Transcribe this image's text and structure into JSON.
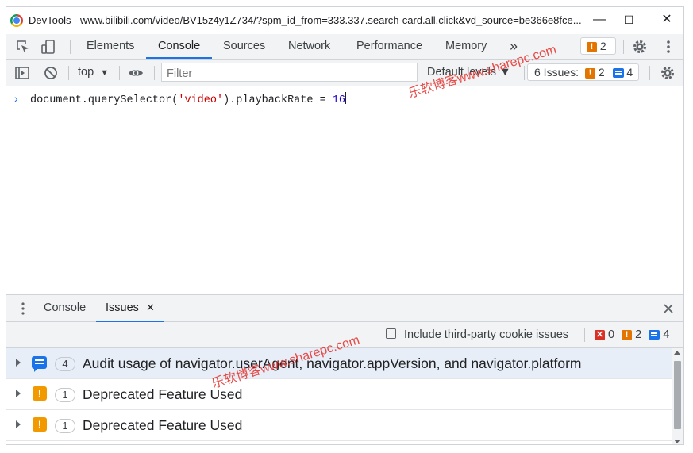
{
  "window": {
    "title": "DevTools - www.bilibili.com/video/BV15z4y1Z734/?spm_id_from=333.337.search-card.all.click&vd_source=be366e8fce...",
    "min_glyph": "—",
    "max_glyph": "☐",
    "close_glyph": "✕"
  },
  "tabs": [
    "Elements",
    "Console",
    "Sources",
    "Network",
    "Performance",
    "Memory"
  ],
  "more_tabs_glyph": "»",
  "header_issues": {
    "warning_count": "2"
  },
  "console_toolbar": {
    "context": "top",
    "filter_placeholder": "Filter",
    "levels": "Default levels ▼",
    "issues_label": "6 Issues:",
    "warning_count": "2",
    "info_count": "4"
  },
  "console": {
    "prompt": "›",
    "code_prefix": "document.querySelector(",
    "code_string": "'video'",
    "code_middle": ").playbackRate = ",
    "code_number": "16"
  },
  "drawer": {
    "tabs": [
      "Console",
      "Issues"
    ],
    "issues_close": "✕",
    "third_party_label": "Include third-party cookie issues",
    "error_count": "0",
    "warning_count": "2",
    "info_count": "4",
    "issues": [
      {
        "type": "info",
        "count": "4",
        "text": "Audit usage of navigator.userAgent, navigator.appVersion, and navigator.platform"
      },
      {
        "type": "warning",
        "count": "1",
        "text": "Deprecated Feature Used"
      },
      {
        "type": "warning",
        "count": "1",
        "text": "Deprecated Feature Used"
      }
    ]
  },
  "watermark": "乐软博客www.sharepc.com",
  "colors": {
    "accent": "#1a73e8",
    "warning": "#f29900",
    "error": "#d93025"
  }
}
